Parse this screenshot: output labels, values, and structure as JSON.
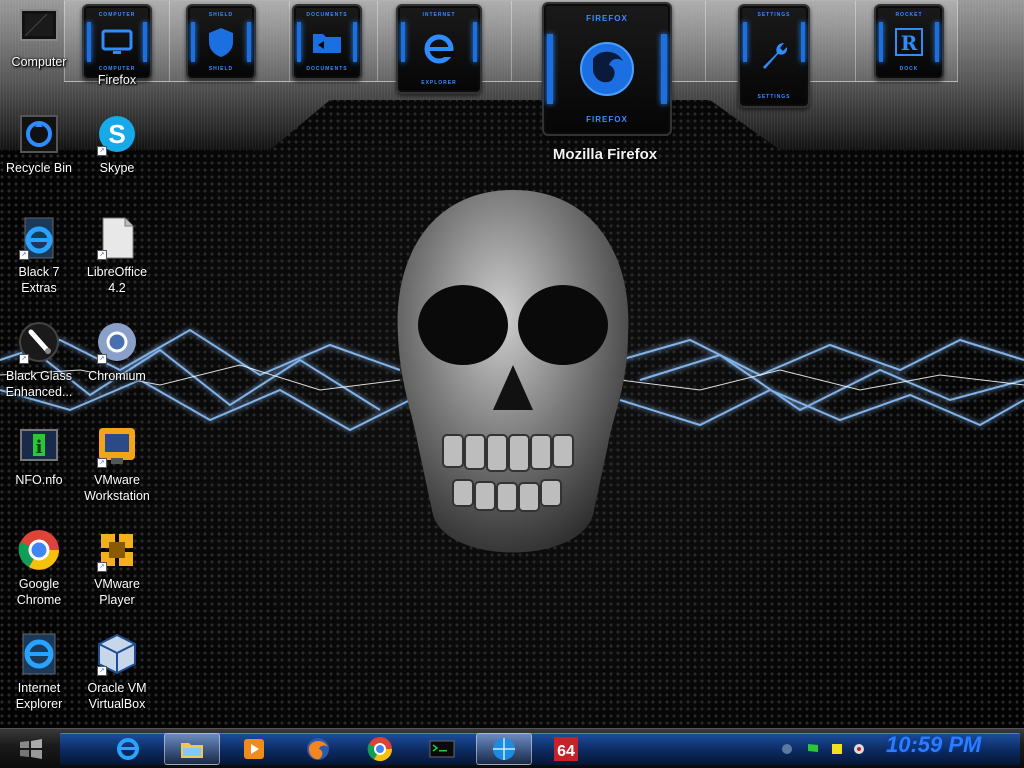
{
  "dock": {
    "items": [
      {
        "caption": "COMPUTER",
        "sub": "COMPUTER",
        "icon": "monitor-icon"
      },
      {
        "caption": "SHIELD",
        "sub": "SHIELD",
        "icon": "shield-icon"
      },
      {
        "caption": "DOCUMENTS",
        "sub": "DOCUMENTS",
        "icon": "folder-icon"
      },
      {
        "caption": "INTERNET",
        "sub": "EXPLORER",
        "icon": "internet-explorer-icon"
      },
      {
        "caption": "FIREFOX",
        "sub": "FIREFOX",
        "icon": "firefox-icon"
      },
      {
        "caption": "SETTINGS",
        "sub": "SETTINGS",
        "icon": "wrench-icon"
      },
      {
        "caption": "ROCKET",
        "sub": "DOCK",
        "icon": "rocketdock-icon"
      }
    ],
    "hover_label": "Mozilla Firefox"
  },
  "desktop_icons": [
    {
      "label": "Computer",
      "icon": "computer-icon"
    },
    {
      "label": "Firefox",
      "icon": "firefox-icon"
    },
    {
      "label": "Recycle Bin",
      "icon": "recycle-bin-icon"
    },
    {
      "label": "Skype",
      "icon": "skype-icon"
    },
    {
      "label": "Black 7 Extras",
      "icon": "internet-explorer-icon"
    },
    {
      "label": "LibreOffice 4.2",
      "icon": "libreoffice-icon"
    },
    {
      "label": "Black Glass Enhanced...",
      "icon": "brush-icon"
    },
    {
      "label": "Chromium",
      "icon": "chromium-icon"
    },
    {
      "label": "NFO.nfo",
      "icon": "info-icon"
    },
    {
      "label": "VMware Workstation",
      "icon": "vmware-workstation-icon"
    },
    {
      "label": "Google Chrome",
      "icon": "chrome-icon"
    },
    {
      "label": "VMware Player",
      "icon": "vmware-player-icon"
    },
    {
      "label": "Internet Explorer",
      "icon": "internet-explorer-icon"
    },
    {
      "label": "Oracle VM VirtualBox",
      "icon": "virtualbox-icon"
    }
  ],
  "taskbar": {
    "pinned": [
      {
        "icon": "internet-explorer-icon"
      },
      {
        "icon": "file-explorer-icon",
        "active": true
      },
      {
        "icon": "media-player-icon"
      },
      {
        "icon": "firefox-icon"
      },
      {
        "icon": "chrome-icon"
      },
      {
        "icon": "terminal-icon"
      },
      {
        "icon": "globe-icon",
        "active": true
      },
      {
        "icon": "badge-64-icon",
        "text": "64"
      }
    ],
    "clock": "10:59 PM"
  },
  "colors": {
    "accent_blue": "#2b7dff",
    "taskbar_blue": "#0c2a60",
    "dock_glow": "#1c6fe0"
  }
}
